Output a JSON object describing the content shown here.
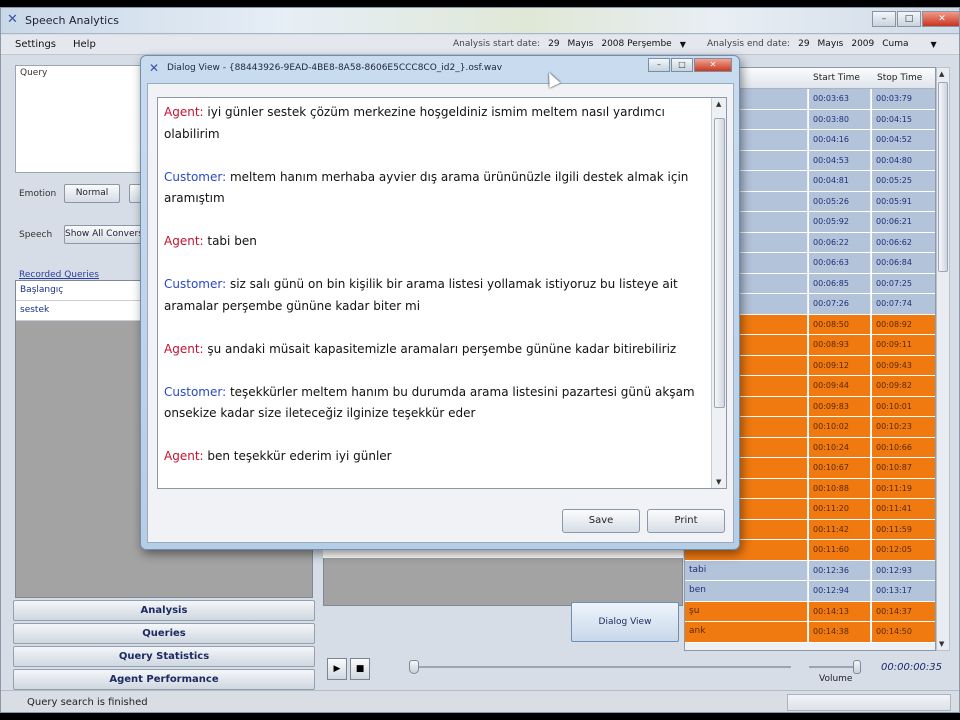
{
  "app": {
    "title": "Speech Analytics",
    "window_buttons": [
      "–",
      "□",
      "✕"
    ]
  },
  "menu": {
    "settings": "Settings",
    "help": "Help"
  },
  "dates": {
    "start_label": "Analysis start date:",
    "start_day": "29",
    "start_month": "Mayıs",
    "start_year_day": "2008 Perşembe",
    "end_label": "Analysis end date:",
    "end_day": "29",
    "end_month": "Mayıs",
    "end_year_day": "2009",
    "end_weekday": "Cuma"
  },
  "left": {
    "query_label": "Query",
    "emotion_label": "Emotion",
    "emotion_btn": "Normal",
    "speech_label": "Speech",
    "speech_btn": "Show All Conversations",
    "recorded_queries_label": "Recorded Queries",
    "recorded_queries": [
      "Başlangıç",
      "sestek"
    ],
    "nav": [
      "Analysis",
      "Queries",
      "Query Statistics",
      "Agent Performance"
    ]
  },
  "table": {
    "headers": [
      "",
      "Start Time",
      "Stop Time"
    ],
    "rows": [
      {
        "word": "",
        "start": "00:03:63",
        "stop": "00:03:79",
        "style": "b"
      },
      {
        "word": "",
        "start": "00:03:80",
        "stop": "00:04:15",
        "style": "b"
      },
      {
        "word": "",
        "start": "00:04:16",
        "stop": "00:04:52",
        "style": "b"
      },
      {
        "word": "",
        "start": "00:04:53",
        "stop": "00:04:80",
        "style": "b"
      },
      {
        "word": "",
        "start": "00:04:81",
        "stop": "00:05:25",
        "style": "b"
      },
      {
        "word": "",
        "start": "00:05:26",
        "stop": "00:05:91",
        "style": "b"
      },
      {
        "word": "",
        "start": "00:05:92",
        "stop": "00:06:21",
        "style": "b"
      },
      {
        "word": "",
        "start": "00:06:22",
        "stop": "00:06:62",
        "style": "b"
      },
      {
        "word": "",
        "start": "00:06:63",
        "stop": "00:06:84",
        "style": "b"
      },
      {
        "word": "",
        "start": "00:06:85",
        "stop": "00:07:25",
        "style": "b"
      },
      {
        "word": "",
        "start": "00:07:26",
        "stop": "00:07:74",
        "style": "b"
      },
      {
        "word": "",
        "start": "00:08:50",
        "stop": "00:08:92",
        "style": "o"
      },
      {
        "word": "",
        "start": "00:08:93",
        "stop": "00:09:11",
        "style": "o"
      },
      {
        "word": "",
        "start": "00:09:12",
        "stop": "00:09:43",
        "style": "o"
      },
      {
        "word": "",
        "start": "00:09:44",
        "stop": "00:09:82",
        "style": "o"
      },
      {
        "word": "",
        "start": "00:09:83",
        "stop": "00:10:01",
        "style": "o"
      },
      {
        "word": "",
        "start": "00:10:02",
        "stop": "00:10:23",
        "style": "o"
      },
      {
        "word": "",
        "start": "00:10:24",
        "stop": "00:10:66",
        "style": "o"
      },
      {
        "word": "",
        "start": "00:10:67",
        "stop": "00:10:87",
        "style": "o"
      },
      {
        "word": "",
        "start": "00:10:88",
        "stop": "00:11:19",
        "style": "o"
      },
      {
        "word": "",
        "start": "00:11:20",
        "stop": "00:11:41",
        "style": "o"
      },
      {
        "word": "",
        "start": "00:11:42",
        "stop": "00:11:59",
        "style": "o"
      },
      {
        "word": "",
        "start": "00:11:60",
        "stop": "00:12:05",
        "style": "o"
      },
      {
        "word": "tabi",
        "start": "00:12:36",
        "stop": "00:12:93",
        "style": "b"
      },
      {
        "word": "ben",
        "start": "00:12:94",
        "stop": "00:13:17",
        "style": "b"
      },
      {
        "word": "şu",
        "start": "00:14:13",
        "stop": "00:14:37",
        "style": "o"
      },
      {
        "word": "ank",
        "start": "00:14:38",
        "stop": "00:14:50",
        "style": "o"
      }
    ]
  },
  "center": {
    "dialog_view_btn": "Dialog View"
  },
  "player": {
    "play": "▶",
    "stop": "■",
    "volume_label": "Volume",
    "time": "00:00:00:35"
  },
  "status": {
    "text": "Query search is finished"
  },
  "dialog": {
    "title": "Dialog View - {88443926-9EAD-4BE8-8A58-8606E5CCC8CO_id2_}.osf.wav",
    "buttons": [
      "–",
      "□",
      "✕"
    ],
    "save": "Save",
    "print": "Print",
    "lines": [
      {
        "speaker": "Agent:",
        "type": "agent",
        "text": " iyi günler sestek çözüm merkezine hoşgeldiniz ismim meltem nasıl yardımcı olabilirim"
      },
      {
        "speaker": "Customer:",
        "type": "customer",
        "text": " meltem hanım merhaba ayvier dış arama ürününüzle ilgili destek almak için aramıştım"
      },
      {
        "speaker": "Agent:",
        "type": "agent",
        "text": " tabi ben"
      },
      {
        "speaker": "Customer:",
        "type": "customer",
        "text": " siz salı günü on bin kişilik bir arama listesi yollamak istiyoruz bu listeye ait aramalar perşembe gününe kadar biter mi"
      },
      {
        "speaker": "Agent:",
        "type": "agent",
        "text": " şu andaki müsait kapasitemizle aramaları perşembe gününe kadar bitirebiliriz"
      },
      {
        "speaker": "Customer:",
        "type": "customer",
        "text": " teşekkürler meltem hanım bu durumda arama listesini pazartesi günü akşam onsekize kadar size ileteceğiz ilginize teşekkür eder"
      },
      {
        "speaker": "Agent:",
        "type": "agent",
        "text": " ben teşekkür ederim iyi günler"
      }
    ]
  }
}
